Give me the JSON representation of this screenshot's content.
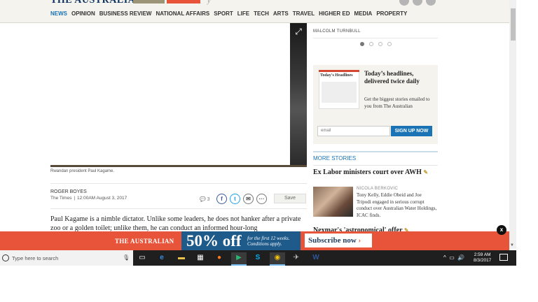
{
  "header": {
    "logo": "THE AUSTRALIAN",
    "nav": [
      "NEWS",
      "OPINION",
      "BUSINESS REVIEW",
      "NATIONAL AFFAIRS",
      "SPORT",
      "LIFE",
      "TECH",
      "ARTS",
      "TRAVEL",
      "HIGHER ED",
      "MEDIA",
      "PROPERTY"
    ],
    "active_nav": "NEWS"
  },
  "article": {
    "caption": "Rwandan president Paul Kagame.",
    "author": "ROGER BOYES",
    "source": "The Times",
    "date": "12:00AM August 3, 2017",
    "comments": "3",
    "save_label": "Save",
    "body": "Paul Kagame is a nimble dictator. Unlike some leaders, he does not hanker after a private zoo or a golden toilet; unlike them, he can conduct an informed hour-long"
  },
  "sidebar": {
    "carousel_label": "MALCOLM TURNBULL",
    "promo": {
      "thumb_title": "Today's Headlines",
      "title": "Today’s headlines, delivered twice daily",
      "text": "Get the biggest stories emailed to you from The Australian",
      "email_placeholder": "email",
      "signup_label": "SIGN UP NOW"
    },
    "more_stories_title": "MORE STORIES",
    "story1": {
      "headline": "Ex Labor ministers court over AWH",
      "author": "NICOLA BERKOVIC",
      "text": "Tony Kelly, Eddie Obeid and Joe Tripodi engaged in serious corrupt conduct over Australian Water Holdings, ICAC finds."
    },
    "story2": {
      "headline": "Nexmar's 'astronomical' offer"
    }
  },
  "ad": {
    "logo": "THE AUSTRALIAN",
    "offer": "50% off",
    "terms": "for the first 12 weeks. Conditions apply.",
    "subscribe_label": "Subscribe now",
    "close_label": "x"
  },
  "taskbar": {
    "search_placeholder": "Type here to search",
    "time": "2:59 AM",
    "date": "8/3/2017"
  }
}
